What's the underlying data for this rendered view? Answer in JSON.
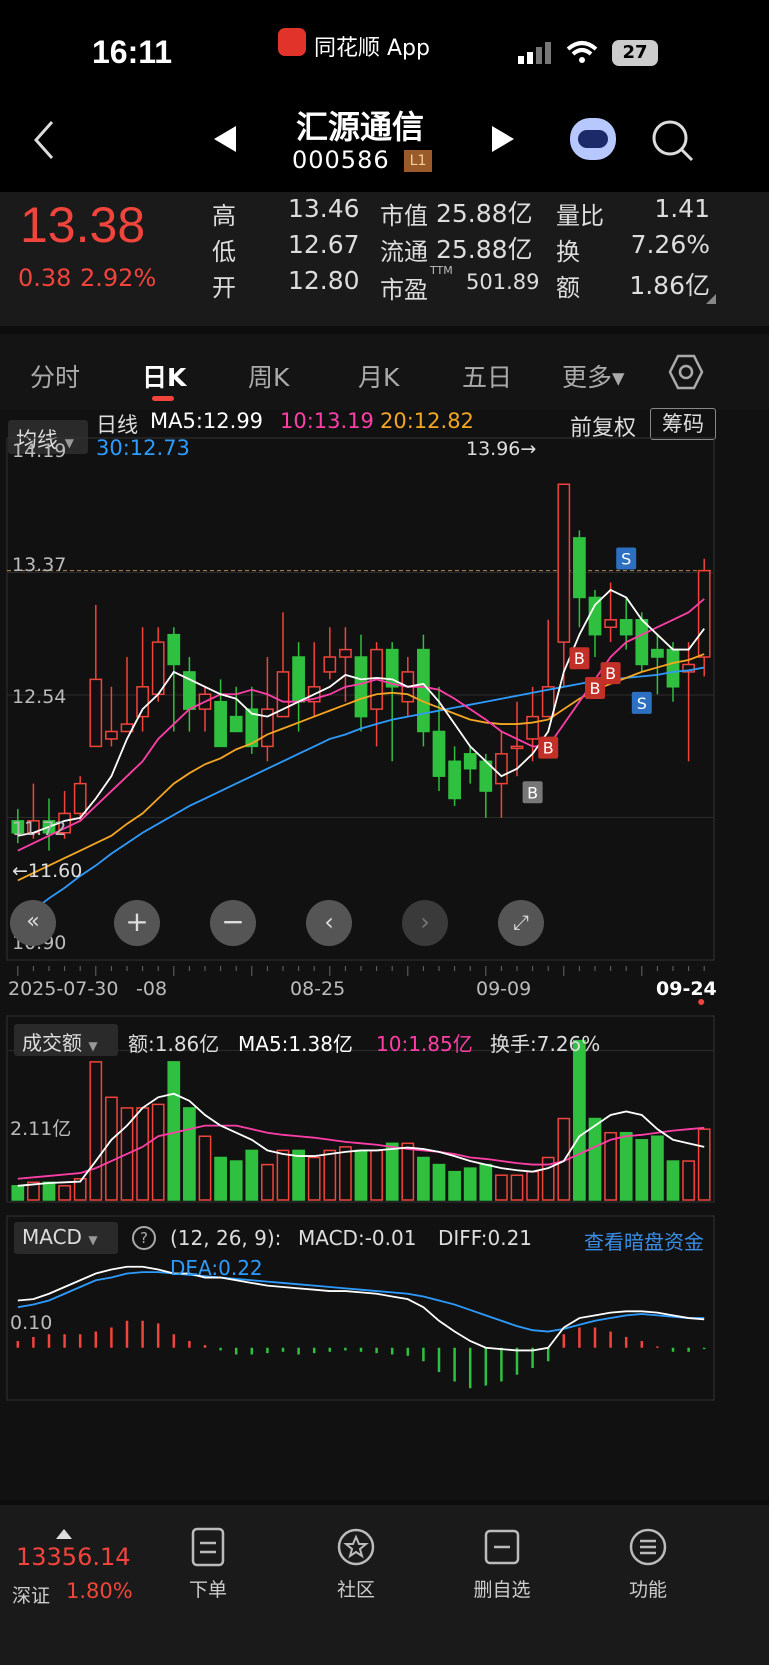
{
  "status": {
    "time": "16:11",
    "app": "同花顺 App",
    "battery": "27"
  },
  "nav": {
    "name": "汇源通信",
    "code": "000586",
    "level": "L1"
  },
  "quote": {
    "price": "13.38",
    "change": "0.38",
    "change_pct": "2.92%",
    "high_label": "高",
    "high": "13.46",
    "low_label": "低",
    "low": "12.67",
    "open_label": "开",
    "open": "12.80",
    "mcap_label": "市值",
    "mcap": "25.88亿",
    "float_label": "流通",
    "float": "25.88亿",
    "pe_label": "市盈",
    "pe_sup": "TTM",
    "pe": "501.89",
    "vr_label": "量比",
    "vr": "1.41",
    "turn_label": "换",
    "turn": "7.26%",
    "amt_label": "额",
    "amt": "1.86亿"
  },
  "tabs": [
    "分时",
    "日K",
    "周K",
    "月K",
    "五日",
    "更多▾"
  ],
  "kline": {
    "ma_btn": "均线",
    "line": "日线",
    "ma5": "MA5:12.99",
    "ma10": "10:13.19",
    "ma20": "20:12.82",
    "ma30": "30:12.73",
    "adjust": "前复权",
    "chip": "筹码",
    "y_labels": [
      "14.19",
      "13.37",
      "12.54",
      "11.72",
      "10.90"
    ],
    "high_mark": "13.96→",
    "low_mark": "←11.60",
    "dates": [
      "2025-07-30",
      "-08",
      "08-25",
      "09-09",
      "09-24"
    ]
  },
  "volume": {
    "btn": "成交额",
    "amt": "额:1.86亿",
    "ma5": "MA5:1.38亿",
    "ma10": "10:1.85亿",
    "turn": "换手:7.26%",
    "y_label": "2.11亿"
  },
  "macd": {
    "btn": "MACD",
    "params": "(12, 26, 9):",
    "macd": "MACD:-0.01",
    "diff": "DIFF:0.21",
    "dea": "DEA:0.22",
    "link": "查看暗盘资金",
    "y_label": "0.10"
  },
  "bottom": {
    "index_value": "13356.14",
    "index_name": "深证",
    "index_pct": "1.80%",
    "order": "下单",
    "community": "社区",
    "remove": "删自选",
    "func": "功能"
  },
  "colors": {
    "up": "#f0443c",
    "down": "#2fc03f",
    "ma5": "#ffffff",
    "ma10": "#ff3fa8",
    "ma20": "#f5a623",
    "ma30": "#2e9cff",
    "link": "#3a8ee6"
  },
  "chart_data": {
    "type": "candlestick",
    "candles": [
      [
        11.7,
        11.62,
        11.78,
        11.55
      ],
      [
        11.62,
        11.7,
        11.95,
        11.58
      ],
      [
        11.7,
        11.62,
        11.85,
        11.5
      ],
      [
        11.62,
        11.75,
        11.9,
        11.58
      ],
      [
        11.75,
        11.95,
        12.0,
        11.7
      ],
      [
        12.2,
        12.65,
        13.15,
        12.2
      ],
      [
        12.25,
        12.3,
        12.6,
        12.2
      ],
      [
        12.3,
        12.35,
        12.8,
        12.3
      ],
      [
        12.4,
        12.6,
        13.0,
        12.3
      ],
      [
        12.55,
        12.9,
        13.0,
        12.5
      ],
      [
        12.95,
        12.75,
        13.0,
        12.3
      ],
      [
        12.7,
        12.45,
        12.8,
        12.3
      ],
      [
        12.45,
        12.55,
        12.6,
        12.3
      ],
      [
        12.5,
        12.2,
        12.65,
        12.2
      ],
      [
        12.4,
        12.3,
        12.6,
        12.3
      ],
      [
        12.45,
        12.2,
        12.6,
        12.15
      ],
      [
        12.2,
        12.45,
        12.8,
        12.1
      ],
      [
        12.4,
        12.7,
        13.1,
        12.4
      ],
      [
        12.8,
        12.5,
        12.9,
        12.3
      ],
      [
        12.5,
        12.6,
        12.9,
        12.4
      ],
      [
        12.7,
        12.8,
        13.0,
        12.65
      ],
      [
        12.8,
        12.85,
        13.0,
        12.5
      ],
      [
        12.8,
        12.4,
        12.95,
        12.3
      ],
      [
        12.45,
        12.85,
        12.9,
        12.2
      ],
      [
        12.85,
        12.6,
        12.9,
        12.1
      ],
      [
        12.5,
        12.7,
        12.8,
        12.4
      ],
      [
        12.85,
        12.3,
        12.95,
        12.2
      ],
      [
        12.3,
        12.0,
        12.6,
        11.9
      ],
      [
        12.1,
        11.85,
        12.2,
        11.8
      ],
      [
        12.15,
        12.05,
        12.2,
        11.95
      ],
      [
        12.1,
        11.9,
        12.15,
        11.72
      ],
      [
        11.95,
        12.15,
        12.3,
        11.72
      ],
      [
        12.2,
        12.2,
        12.5,
        12.0
      ],
      [
        12.25,
        12.4,
        12.6,
        12.1
      ],
      [
        12.4,
        12.6,
        13.05,
        12.4
      ],
      [
        12.9,
        13.96,
        13.96,
        12.6
      ],
      [
        13.6,
        13.2,
        13.65,
        13.0
      ],
      [
        13.2,
        12.95,
        13.25,
        12.8
      ],
      [
        13.0,
        13.05,
        13.3,
        12.9
      ],
      [
        13.05,
        12.95,
        13.2,
        12.85
      ],
      [
        13.05,
        12.75,
        13.1,
        12.7
      ],
      [
        12.85,
        12.8,
        12.95,
        12.55
      ],
      [
        12.85,
        12.6,
        12.9,
        12.5
      ],
      [
        12.7,
        12.75,
        12.9,
        12.1
      ],
      [
        12.8,
        13.38,
        13.46,
        12.67
      ]
    ],
    "ma5": [
      11.6,
      11.62,
      11.66,
      11.7,
      11.72,
      11.85,
      12.0,
      12.25,
      12.45,
      12.55,
      12.7,
      12.65,
      12.6,
      12.55,
      12.52,
      12.42,
      12.4,
      12.45,
      12.5,
      12.55,
      12.6,
      12.68,
      12.65,
      12.66,
      12.65,
      12.6,
      12.62,
      12.5,
      12.35,
      12.2,
      12.1,
      12.0,
      12.05,
      12.15,
      12.3,
      12.7,
      12.95,
      13.15,
      13.25,
      13.2,
      13.05,
      12.95,
      12.85,
      12.85,
      12.99
    ],
    "ma10": [
      11.5,
      11.55,
      11.6,
      11.65,
      11.7,
      11.8,
      11.9,
      12.0,
      12.1,
      12.25,
      12.35,
      12.45,
      12.5,
      12.55,
      12.55,
      12.58,
      12.55,
      12.5,
      12.5,
      12.52,
      12.55,
      12.6,
      12.62,
      12.65,
      12.62,
      12.6,
      12.6,
      12.58,
      12.52,
      12.45,
      12.38,
      12.3,
      12.25,
      12.2,
      12.2,
      12.35,
      12.5,
      12.65,
      12.8,
      12.9,
      12.95,
      13.0,
      13.05,
      13.1,
      13.19
    ],
    "ma20": [
      11.3,
      11.35,
      11.4,
      11.45,
      11.5,
      11.55,
      11.6,
      11.68,
      11.75,
      11.85,
      11.95,
      12.02,
      12.08,
      12.12,
      12.18,
      12.22,
      12.28,
      12.32,
      12.36,
      12.4,
      12.44,
      12.48,
      12.52,
      12.55,
      12.56,
      12.55,
      12.5,
      12.46,
      12.42,
      12.38,
      12.36,
      12.35,
      12.35,
      12.36,
      12.38,
      12.45,
      12.52,
      12.58,
      12.62,
      12.66,
      12.7,
      12.73,
      12.76,
      12.78,
      12.82
    ],
    "ma30": [
      11.05,
      11.1,
      11.18,
      11.25,
      11.33,
      11.4,
      11.48,
      11.55,
      11.62,
      11.68,
      11.74,
      11.8,
      11.85,
      11.9,
      11.95,
      12.0,
      12.05,
      12.1,
      12.15,
      12.2,
      12.25,
      12.28,
      12.32,
      12.35,
      12.38,
      12.4,
      12.42,
      12.44,
      12.46,
      12.48,
      12.5,
      12.52,
      12.54,
      12.56,
      12.58,
      12.6,
      12.62,
      12.64,
      12.65,
      12.66,
      12.67,
      12.68,
      12.7,
      12.71,
      12.73
    ],
    "y_range": [
      10.9,
      14.19
    ],
    "volume": [
      0.2,
      0.25,
      0.25,
      0.2,
      0.3,
      1.95,
      1.45,
      1.3,
      1.3,
      1.35,
      1.95,
      1.3,
      0.9,
      0.6,
      0.55,
      0.7,
      0.5,
      0.7,
      0.7,
      0.6,
      0.7,
      0.75,
      0.7,
      0.7,
      0.8,
      0.8,
      0.6,
      0.5,
      0.4,
      0.45,
      0.5,
      0.35,
      0.35,
      0.4,
      0.6,
      1.15,
      2.25,
      1.15,
      0.95,
      0.95,
      0.85,
      0.9,
      0.55,
      0.55,
      1.0
    ],
    "vol_ma5": [
      0.2,
      0.22,
      0.24,
      0.25,
      0.26,
      0.55,
      0.85,
      1.05,
      1.3,
      1.45,
      1.5,
      1.4,
      1.2,
      1.05,
      0.95,
      0.85,
      0.7,
      0.65,
      0.62,
      0.62,
      0.65,
      0.68,
      0.7,
      0.7,
      0.72,
      0.74,
      0.72,
      0.68,
      0.62,
      0.55,
      0.5,
      0.45,
      0.42,
      0.4,
      0.45,
      0.55,
      0.9,
      1.05,
      1.2,
      1.25,
      1.2,
      1.0,
      0.85,
      0.8,
      0.75
    ],
    "vol_ma10": [
      0.3,
      0.32,
      0.34,
      0.36,
      0.38,
      0.45,
      0.55,
      0.65,
      0.75,
      0.9,
      0.95,
      1.0,
      1.05,
      1.05,
      1.05,
      1.0,
      0.95,
      0.92,
      0.9,
      0.88,
      0.85,
      0.82,
      0.8,
      0.78,
      0.75,
      0.72,
      0.7,
      0.68,
      0.65,
      0.6,
      0.58,
      0.55,
      0.52,
      0.5,
      0.5,
      0.55,
      0.65,
      0.75,
      0.85,
      0.9,
      0.92,
      0.95,
      0.98,
      1.0,
      1.02
    ],
    "vol_ylabel": 2.11,
    "diff": [
      0.35,
      0.36,
      0.4,
      0.45,
      0.5,
      0.55,
      0.58,
      0.6,
      0.6,
      0.58,
      0.55,
      0.55,
      0.52,
      0.52,
      0.5,
      0.48,
      0.46,
      0.45,
      0.44,
      0.43,
      0.42,
      0.42,
      0.41,
      0.4,
      0.38,
      0.36,
      0.3,
      0.2,
      0.12,
      0.05,
      0.0,
      -0.01,
      -0.02,
      -0.02,
      0.0,
      0.15,
      0.22,
      0.24,
      0.26,
      0.27,
      0.27,
      0.26,
      0.24,
      0.22,
      0.21
    ],
    "dea": [
      0.3,
      0.32,
      0.35,
      0.4,
      0.45,
      0.5,
      0.52,
      0.55,
      0.56,
      0.56,
      0.55,
      0.54,
      0.53,
      0.52,
      0.51,
      0.5,
      0.49,
      0.48,
      0.47,
      0.46,
      0.45,
      0.44,
      0.43,
      0.42,
      0.41,
      0.4,
      0.38,
      0.35,
      0.32,
      0.28,
      0.24,
      0.2,
      0.16,
      0.13,
      0.12,
      0.14,
      0.17,
      0.2,
      0.22,
      0.24,
      0.25,
      0.24,
      0.23,
      0.22,
      0.22
    ],
    "macd_bar": [
      0.05,
      0.08,
      0.1,
      0.1,
      0.1,
      0.12,
      0.15,
      0.2,
      0.2,
      0.18,
      0.1,
      0.05,
      0.02,
      -0.02,
      -0.05,
      -0.05,
      -0.04,
      -0.03,
      -0.05,
      -0.04,
      -0.03,
      -0.02,
      -0.03,
      -0.04,
      -0.05,
      -0.06,
      -0.1,
      -0.18,
      -0.25,
      -0.3,
      -0.28,
      -0.25,
      -0.2,
      -0.15,
      -0.1,
      0.1,
      0.15,
      0.15,
      0.12,
      0.08,
      0.05,
      0.01,
      -0.03,
      -0.03,
      -0.01
    ],
    "markers": [
      {
        "i": 33,
        "t": "B",
        "c": "gray"
      },
      {
        "i": 34,
        "t": "B",
        "c": "red"
      },
      {
        "i": 36,
        "t": "B",
        "c": "red"
      },
      {
        "i": 37,
        "t": "B",
        "c": "red"
      },
      {
        "i": 38,
        "t": "B",
        "c": "red"
      },
      {
        "i": 39,
        "t": "S",
        "c": "blue"
      },
      {
        "i": 40,
        "t": "S",
        "c": "blue"
      }
    ]
  }
}
